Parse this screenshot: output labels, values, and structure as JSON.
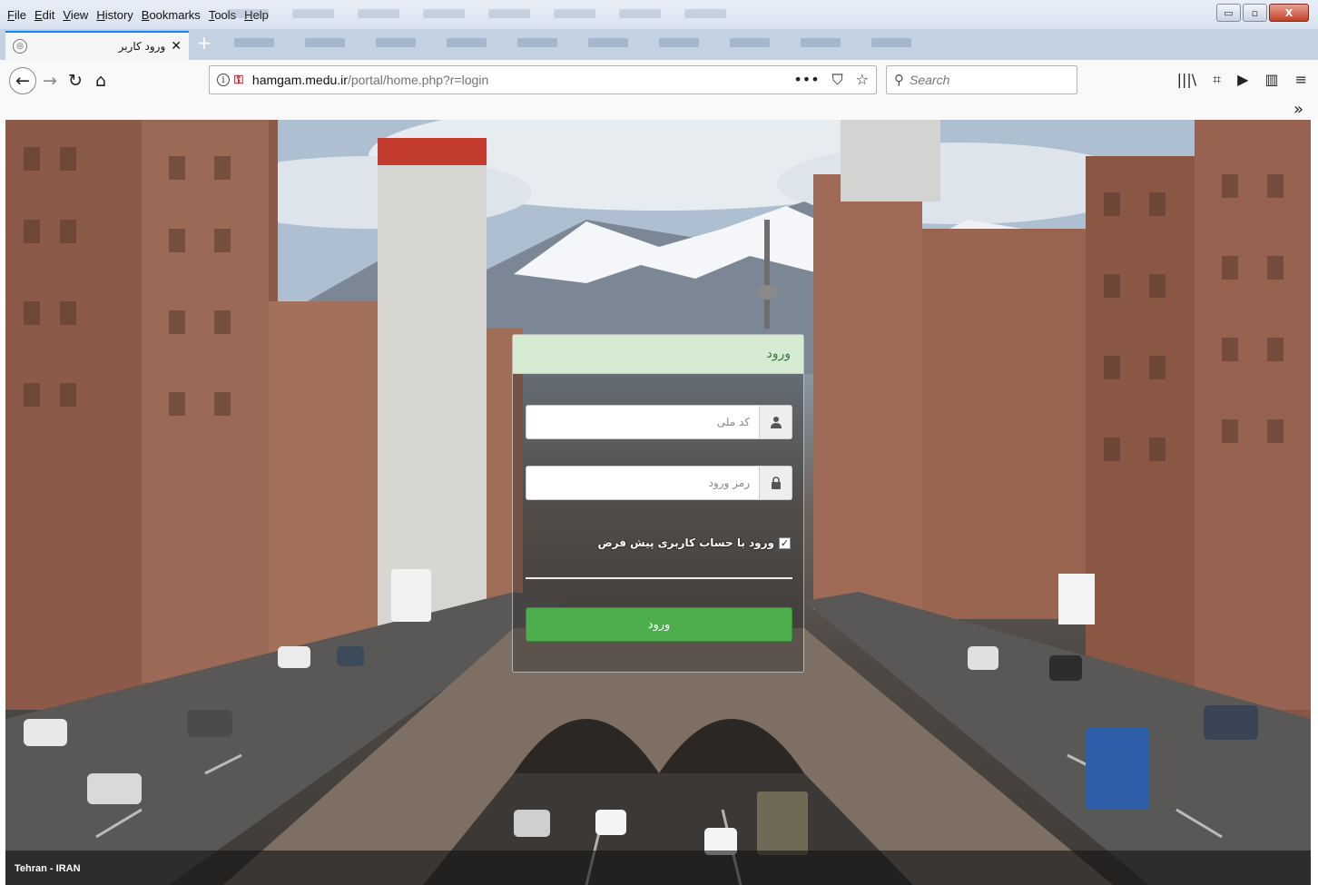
{
  "menubar": {
    "items": [
      "File",
      "Edit",
      "View",
      "History",
      "Bookmarks",
      "Tools",
      "Help"
    ]
  },
  "window_controls": {
    "minimize": "▭",
    "maximize": "▫",
    "close": "X"
  },
  "tab": {
    "title": "ورود کاربر",
    "close_glyph": "✕",
    "new_tab_glyph": "+"
  },
  "navbar": {
    "url_host": "hamgam.medu.ir",
    "url_path": "/portal/home.php?r=login",
    "search_placeholder": "Search",
    "overflow_glyph": "»"
  },
  "icons": {
    "back": "←",
    "forward": "→",
    "reload": "↻",
    "home": "⌂",
    "page_actions": "•••",
    "pocket": "⛉",
    "bookmark_star": "☆",
    "library": "|||\\",
    "screenshot": "⌗",
    "reader": "▶",
    "sidebar": "▥",
    "hamburger": "≡"
  },
  "login": {
    "title": "ورود",
    "national_code_placeholder": "کد ملی",
    "password_placeholder": "رمز ورود",
    "remember_label": "ورود با حساب کاربری پیش فرض",
    "remember_checked": true,
    "submit_label": "ورود"
  },
  "background": {
    "caption": "Tehran - IRAN"
  },
  "colors": {
    "accent_tab": "#0a84ff",
    "login_header_bg": "#d6ecd2",
    "login_header_text": "#3c763d",
    "login_button_bg": "#4cae4c"
  }
}
